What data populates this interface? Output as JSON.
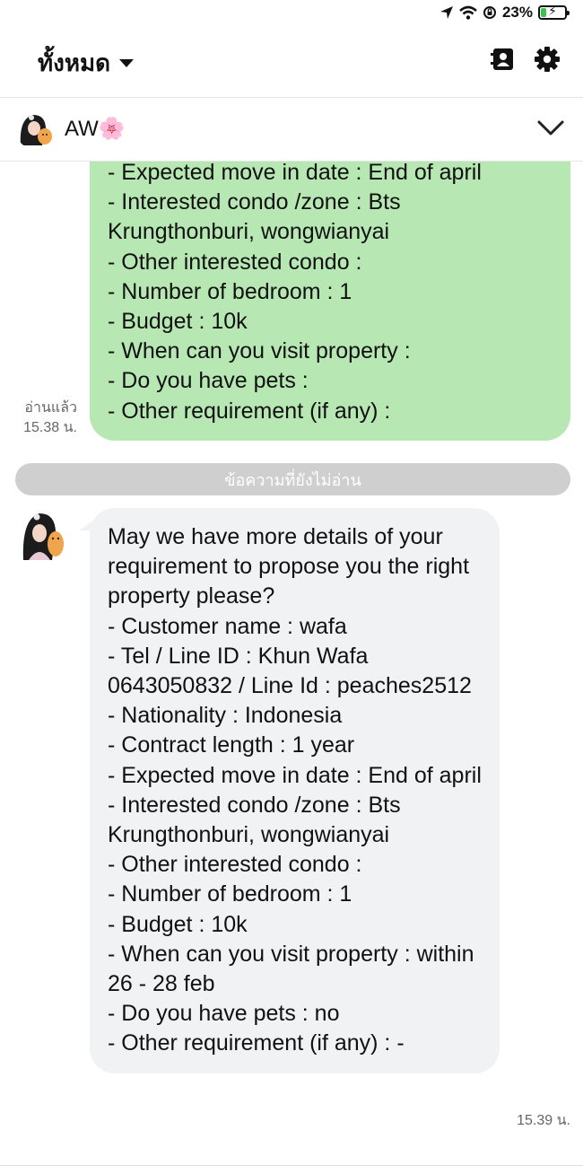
{
  "status": {
    "battery_text": "23%",
    "battery_level": 0.23
  },
  "top_bar": {
    "filter_label": "ทั้งหมด"
  },
  "chat_header": {
    "contact_name": "AW🌸"
  },
  "messages": {
    "sent": {
      "text": "- Expected move in date : End of april\n- Interested condo /zone : Bts Krungthonburi, wongwianyai\n- Other interested condo :\n- Number of bedroom  : 1\n- Budget : 10k\n- When can you visit property :\n- Do you have pets :\n- Other requirement (if any) :",
      "read_label": "อ่านแล้ว",
      "time": "15.38 น."
    },
    "unread_separator": "ข้อความที่ยังไม่อ่าน",
    "received": {
      "text": "May we have more details of your requirement to propose you the right property please?\n- Customer name : wafa\n- Tel / Line ID : Khun Wafa 0643050832 / Line Id : peaches2512\n- Nationality : Indonesia\n- Contract length : 1 year\n- Expected move in date : End of april\n- Interested condo /zone : Bts Krungthonburi, wongwianyai\n- Other interested condo :\n- Number of bedroom  : 1\n- Budget : 10k\n- When can you visit property : within 26 - 28 feb\n- Do you have pets : no\n- Other requirement (if any) : -",
      "time": "15.39 น."
    }
  },
  "colors": {
    "sent_bubble": "#b7e8b4",
    "received_bubble": "#f1f2f4",
    "separator": "#cfcfcf"
  }
}
